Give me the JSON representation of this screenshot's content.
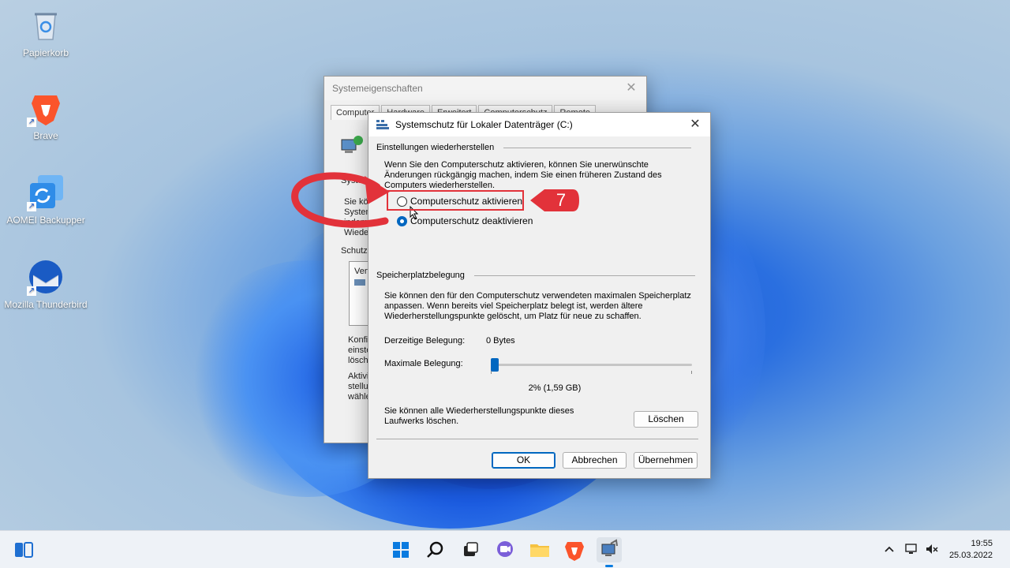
{
  "desktop": {
    "icons": [
      {
        "label": "Papierkorb"
      },
      {
        "label": "Brave"
      },
      {
        "label": "AOMEI Backupper"
      },
      {
        "label": "Mozilla Thunderbird"
      }
    ]
  },
  "bg_window": {
    "title": "Systemeigenschaften",
    "tabs": [
      "Computer",
      "Hardware",
      "Erweitert",
      "Computerschutz",
      "Remote"
    ],
    "fragments": [
      "Syste",
      "Sie kön",
      "System",
      "indem",
      "Wiede",
      "Schutz",
      "Verf",
      "Konfi",
      "einste",
      "lösch",
      "Aktivi",
      "stellu",
      "wähle"
    ]
  },
  "dialog": {
    "title": "Systemschutz für Lokaler Datenträger (C:)",
    "restore_section": "Einstellungen wiederherstellen",
    "restore_text": "Wenn Sie den Computerschutz aktivieren, können Sie unerwünschte Änderungen rückgängig machen, indem Sie einen früheren Zustand des Computers wiederherstellen.",
    "radio_on_label": "Computerschutz aktivieren",
    "radio_off_label": "Computerschutz deaktivieren",
    "selected_option": "Computerschutz deaktivieren",
    "space_section": "Speicherplatzbelegung",
    "space_text": "Sie können den für den Computerschutz verwendeten maximalen Speicherplatz anpassen. Wenn bereits viel Speicherplatz belegt ist, werden ältere Wiederherstellungspunkte gelöscht, um Platz für neue zu schaffen.",
    "current_label": "Derzeitige Belegung:",
    "current_value": "0 Bytes",
    "max_label": "Maximale Belegung:",
    "slider_percent": 2,
    "slider_value": "2% (1,59 GB)",
    "delete_text": "Sie können alle Wiederherstellungspunkte dieses Laufwerks löschen.",
    "delete_button": "Löschen",
    "ok_button": "OK",
    "cancel_button": "Abbrechen",
    "apply_button": "Übernehmen"
  },
  "annotation": {
    "step": "7",
    "color": "#e2323a"
  },
  "taskbar": {
    "icons": [
      "widgets-icon",
      "start-icon",
      "search-icon",
      "task-view-icon",
      "chat-icon",
      "file-explorer-icon",
      "brave-icon",
      "system-properties-icon"
    ],
    "time": "19:55",
    "date": "25.03.2022"
  },
  "colors": {
    "accent": "#0067c0",
    "annotation_red": "#e2323a"
  }
}
